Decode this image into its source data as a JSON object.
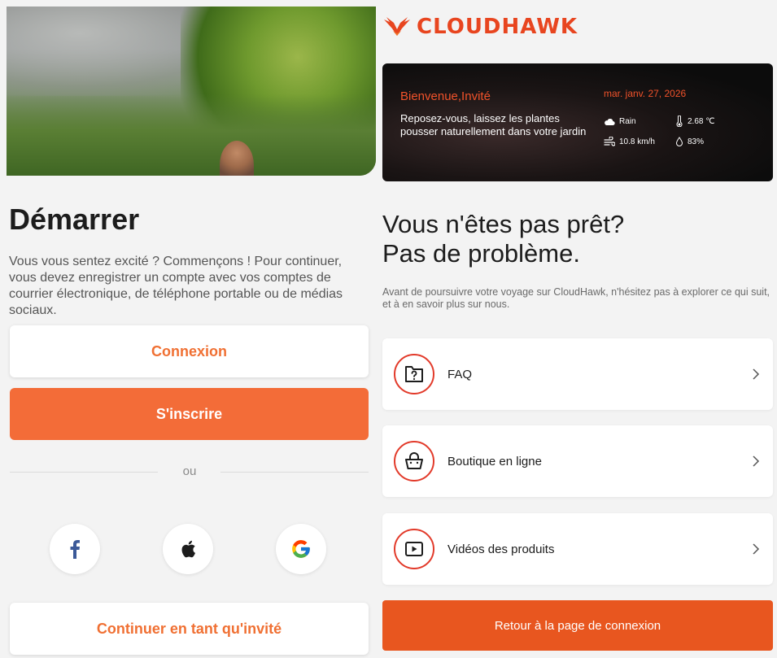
{
  "left": {
    "title": "Démarrer",
    "description": "Vous vous sentez excité ? Commençons ! Pour continuer, vous devez enregistrer un compte avec vos comptes de courrier électronique, de téléphone portable ou de médias sociaux.",
    "login_label": "Connexion",
    "signup_label": "S'inscrire",
    "divider_text": "ou",
    "social": [
      "facebook-icon",
      "apple-icon",
      "google-icon"
    ],
    "guest_label": "Continuer en tant qu'invité"
  },
  "right": {
    "brand": "CLOUDHAWK",
    "weather": {
      "welcome": "Bienvenue,Invité",
      "message": "Reposez-vous, laissez les plantes pousser naturellement dans votre jardin",
      "date": "mar. janv. 27, 2026",
      "condition": "Rain",
      "temperature": "2.68 ℃",
      "wind": "10.8 km/h",
      "humidity": "83%"
    },
    "title_line1": "Vous n'êtes pas prêt?",
    "title_line2": "Pas de problème.",
    "description": "Avant de poursuivre votre voyage sur CloudHawk, n'hésitez pas à explorer ce qui suit, et à en savoir plus sur nous.",
    "cards": [
      {
        "label": "FAQ",
        "icon": "faq-folder-icon"
      },
      {
        "label": "Boutique en ligne",
        "icon": "shopping-basket-icon"
      },
      {
        "label": "Vidéos des produits",
        "icon": "video-play-icon"
      }
    ],
    "back_label": "Retour à la page de connexion"
  },
  "colors": {
    "accent": "#f36c38",
    "brand_red": "#e8451f",
    "facebook": "#3b5998"
  }
}
